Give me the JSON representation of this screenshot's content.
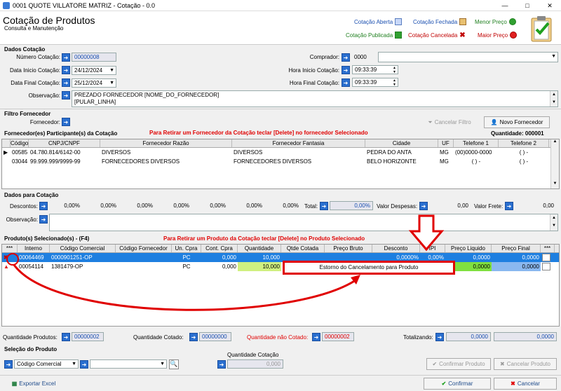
{
  "window": {
    "title": "0001 QUOTE VILLATORE MATRIZ - Cotação - 0.0",
    "min": "—",
    "max": "□",
    "close": "✕"
  },
  "header": {
    "title": "Cotação de Produtos",
    "subtitle": "Consulta e Manutenção",
    "legend": {
      "aberta": "Cotação Aberta",
      "fechada": "Cotação Fechada",
      "menor": "Menor Preço",
      "publicada": "Cotação Publicada",
      "cancelada": "Cotação Cancelada",
      "maior": "Maior Preço"
    }
  },
  "dados": {
    "section": "Dados Cotação",
    "numero_label": "Número Cotação:",
    "numero": "00000008",
    "data_inicio_label": "Data Inicio Cotação:",
    "data_inicio": "24/12/2024",
    "data_final_label": "Data Final Cotação:",
    "data_final": "25/12/2024",
    "observacao_label": "Observação:",
    "observacao_l1": "PREZADO FORNECEDOR [NOME_DO_FORNECEDOR]",
    "observacao_l2": "[PULAR_LINHA]",
    "comprador_label": "Comprador:",
    "comprador": "0000",
    "hora_inicio_label": "Hora Inicio Cotação:",
    "hora_inicio": "09:33:39",
    "hora_final_label": "Hora Final Cotação:",
    "hora_final": "09:33:39"
  },
  "filtro": {
    "section": "Filtro Fornecedor",
    "fornecedor_label": "Fornecedor:",
    "cancelar": "Cancelar Filtro",
    "novo": "Novo Fornecedor"
  },
  "participantes": {
    "section": "Fornecedor(es) Participante(s) da Cotação",
    "hint": "Para Retirar um Fornecedor da Cotação teclar [Delete] no fornecedor Selecionado",
    "quantidade": "Quantidade: 000001",
    "columns": [
      "Código",
      "CNPJ/CNPF",
      "Fornecedor Razão",
      "Fornecedor Fantasia",
      "Cidade",
      "UF",
      "Telefone 1",
      "Telefone 2"
    ],
    "rows": [
      [
        "00585",
        "04.780.814/6142-00",
        "DIVERSOS",
        "DIVERSOS",
        "PEDRA DO ANTA",
        "MG",
        "(00)0000-0000",
        "(  )  -"
      ],
      [
        "03044",
        "99.999.999/9999-99",
        "FORNECEDORES DIVERSOS",
        "FORNECEDORES DIVERSOS",
        "BELO HORIZONTE",
        "MG",
        "(  )  -",
        "(  )  -"
      ]
    ]
  },
  "dados_para": {
    "section": "Dados para Cotação",
    "descontos_label": "Descontos:",
    "descontos": [
      "0,00%",
      "0,00%",
      "0,00%",
      "0,00%",
      "0,00%",
      "0,00%",
      "0,00%"
    ],
    "total_label": "Total:",
    "total": "0,00%",
    "despesas_label": "Valor Despesas:",
    "despesas": "0,00",
    "frete_label": "Valor Frete:",
    "frete": "0,00",
    "observacao_label": "Observação:"
  },
  "produtos": {
    "section": "Produto(s) Selecionado(s) - (F4)",
    "hint": "Para Retirar um Produto da Cotação teclar [Delete] no Produto Selecionado",
    "columns": [
      "***",
      "Interno",
      "Código Comercial",
      "Código Fornecedor",
      "Un. Cpra",
      "Cont. Cpra",
      "Quantidade",
      "Qtde Cotada",
      "Preço Bruto",
      "Desconto",
      "IPI",
      "Preço Liquido",
      "Preço Final",
      "***"
    ],
    "rows": [
      [
        "00064469",
        "0000901251-OP",
        "",
        "PC",
        "0,000",
        "10,000",
        "",
        "",
        "0,0000%",
        "0,00%",
        "0,0000",
        "0,0000"
      ],
      [
        "00054114",
        "1381479-OP",
        "",
        "PC",
        "0,000",
        "10,000",
        "",
        "",
        "",
        "",
        "0,0000",
        "0,0000"
      ]
    ],
    "context_menu": "Estorno do Cancelamento para Produto"
  },
  "totais": {
    "qtd_produtos_label": "Quantidade Produtos:",
    "qtd_produtos": "00000002",
    "qtd_cotado_label": "Quantidade Cotado:",
    "qtd_cotado": "00000000",
    "qtd_nao_label": "Quantidade não Cotado:",
    "qtd_nao": "00000002",
    "totalizando_label": "Totalizando:",
    "tot1": "0,0000",
    "tot2": "0,0000"
  },
  "selecao": {
    "section": "Seleção do Produto",
    "tipo": "Código Comercial",
    "qtd_label": "Quantidade Cotação",
    "qtd": "0,000",
    "confirmar_produto": "Confirmar Produto",
    "cancelar_produto": "Cancelar Produto"
  },
  "footer": {
    "exportar": "Exportar Excel",
    "confirmar": "Confirmar",
    "cancelar": "Cancelar"
  },
  "colors": {
    "accent": "#2a6fcf",
    "selected": "#1e7fe0",
    "green": "#80e040",
    "red": "#e00000"
  }
}
